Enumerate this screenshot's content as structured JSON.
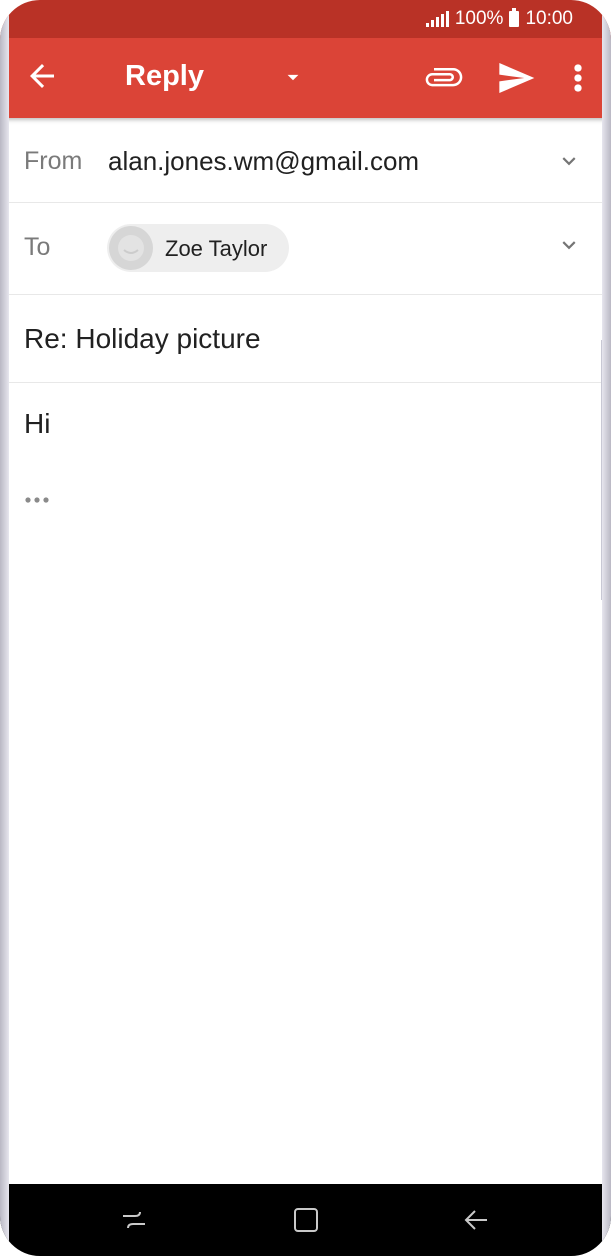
{
  "status_bar": {
    "battery_percent": "100%",
    "time": "10:00"
  },
  "app_bar": {
    "title": "Reply",
    "icons": [
      "back-arrow-icon",
      "dropdown-arrow-icon",
      "attach-icon",
      "send-icon",
      "more-vert-icon"
    ]
  },
  "compose": {
    "from_label": "From",
    "from_value": "alan.jones.wm@gmail.com",
    "to_label": "To",
    "recipient_name": "Zoe Taylor",
    "subject": "Re: Holiday picture",
    "body": "Hi",
    "quoted_text_icon": "ellipsis-icon"
  },
  "nav_bar": {
    "icons": [
      "recent-apps-icon",
      "home-icon",
      "back-icon"
    ]
  },
  "colors": {
    "status_bar": "#b93226",
    "app_bar": "#db4437",
    "text_primary": "#212121",
    "text_secondary": "#7a7a7a"
  }
}
